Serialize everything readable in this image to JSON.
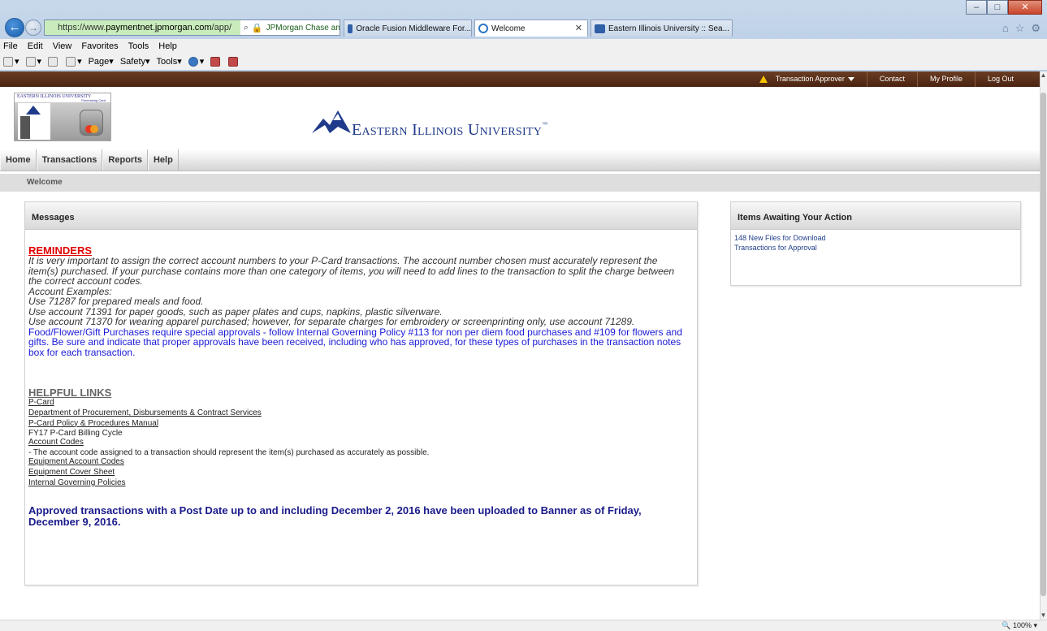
{
  "browser": {
    "url_prefix": "https://www.",
    "url_host": "paymentnet.jpmorgan.com",
    "url_path": "/app/",
    "site_identity": "JPMorgan Chase an...",
    "tabs": [
      {
        "label": "Oracle Fusion Middleware For..."
      },
      {
        "label": "Welcome"
      },
      {
        "label": "Eastern Illinois University :: Sea..."
      }
    ],
    "menu": [
      "File",
      "Edit",
      "View",
      "Favorites",
      "Tools",
      "Help"
    ],
    "commands": [
      "Page",
      "Safety",
      "Tools"
    ],
    "zoom": "100%"
  },
  "utility_menu": {
    "role": "Transaction Approver",
    "contact": "Contact",
    "profile": "My Profile",
    "logout": "Log Out"
  },
  "brand": {
    "pcard_logo_top": "EASTERN ILLINOIS UNIVERSITY",
    "pcard_logo_sub": "Purchasing Card",
    "university_name": "Eastern Illinois University",
    "trademark": "™"
  },
  "nav": [
    "Home",
    "Transactions",
    "Reports",
    "Help"
  ],
  "breadcrumb": "Welcome",
  "messages": {
    "title": "Messages",
    "reminders_heading": "REMINDERS",
    "reminder_lines": [
      "It is very important to assign the correct account numbers to your P-Card transactions.  The account number chosen must accurately represent the item(s) purchased.  If your purchase contains more than one category of items, you will need to add lines to the transaction to split the charge between the correct account codes.",
      "Account Examples:",
      "Use 71287 for prepared meals and food.",
      "Use account 71391 for paper goods, such as paper plates and cups, napkins, plastic silverware.",
      "Use account 71370 for wearing apparel purchased; however, for separate charges for embroidery or screenprinting only, use account 71289."
    ],
    "policy_note": "Food/Flower/Gift Purchases require special approvals - follow Internal Governing Policy #113 for non per diem food purchases and #109 for flowers and gifts.  Be sure and indicate that proper approvals have been received, including who has approved, for these types of purchases in the transaction notes box for each transaction.",
    "links_heading": "HELPFUL LINKS",
    "links": {
      "pcard": "P-Card",
      "procurement": "Department of Procurement, Disbursements & Contract Services",
      "manual": "P-Card Policy & Procedures Manual",
      "billing_cycle": "FY17 P-Card Billing Cycle",
      "account_codes": "Account Codes",
      "account_codes_note": " - The account code assigned to a transaction should represent the item(s) purchased as accurately as possible.",
      "equipment_codes": "Equipment Account Codes",
      "equipment_cover": "Equipment Cover Sheet",
      "policies": "Internal Governing Policies"
    },
    "upload_notice": "Approved transactions with a Post Date up to and including December 2, 2016 have been uploaded to Banner as of Friday, December 9, 2016."
  },
  "actions": {
    "title": "Items Awaiting Your Action",
    "items": [
      "148 New Files for Download",
      "Transactions for Approval"
    ]
  },
  "colors": {
    "brand_blue": "#1f3a8a",
    "header_brown": "#5a2e18",
    "reminder_red": "#e00000",
    "policy_blue": "#1a1ad8"
  }
}
